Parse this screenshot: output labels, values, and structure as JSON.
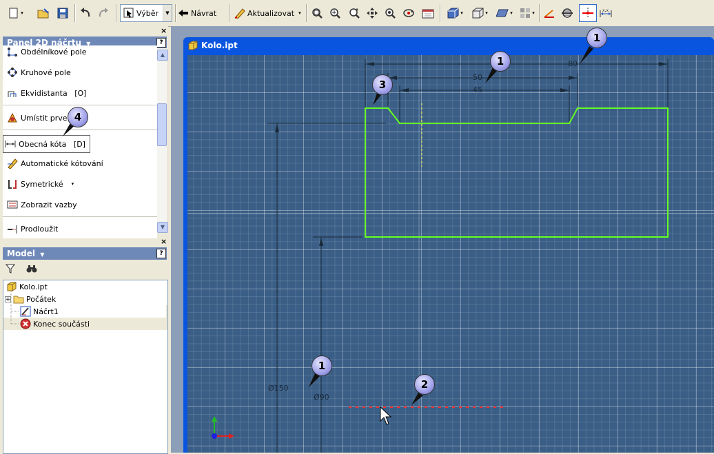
{
  "toolbar": {
    "select_label": "Výběr",
    "return_label": "Návrat",
    "update_label": "Aktualizovat"
  },
  "sketch_panel": {
    "title": "Panel 2D náčrtu",
    "help": "?",
    "items": [
      {
        "label": "Obdélníkové pole",
        "icon": "rect-pattern-icon"
      },
      {
        "label": "Kruhové pole",
        "icon": "circular-pattern-icon"
      },
      {
        "label": "Ekvidistanta   [O]",
        "icon": "offset-icon"
      },
      {
        "label": "Umístit prvek...",
        "icon": "insert-feature-icon"
      },
      {
        "label": "Obecná kóta   [D]",
        "icon": "general-dimension-icon"
      },
      {
        "label": "Automatické kótování",
        "icon": "auto-dimension-icon"
      },
      {
        "label": "Symetrické",
        "icon": "symmetric-icon"
      },
      {
        "label": "Zobrazit vazby",
        "icon": "show-constraints-icon"
      },
      {
        "label": "Prodloužit",
        "icon": "extend-icon"
      }
    ]
  },
  "model_panel": {
    "title": "Model",
    "help": "?",
    "tree": [
      {
        "label": "Kolo.ipt",
        "icon": "part-icon"
      },
      {
        "label": "Počátek",
        "icon": "folder-icon"
      },
      {
        "label": "Náčrt1",
        "icon": "sketch-icon"
      },
      {
        "label": "Konec součásti",
        "icon": "end-of-part-icon"
      }
    ]
  },
  "document": {
    "title": "Kolo.ipt",
    "dims": {
      "d80": "80",
      "d50": "50",
      "d45": "45",
      "d150": "Ø150",
      "d90": "Ø90"
    }
  },
  "callouts": {
    "c1a": "1",
    "c1b": "1",
    "c1c": "1",
    "c2": "2",
    "c3": "3",
    "c4": "4"
  },
  "colors": {
    "canvas": "#3a5e86",
    "profile": "#66ff22",
    "titlebar": "#0a55e0",
    "panel_header": "#6e88b8"
  }
}
